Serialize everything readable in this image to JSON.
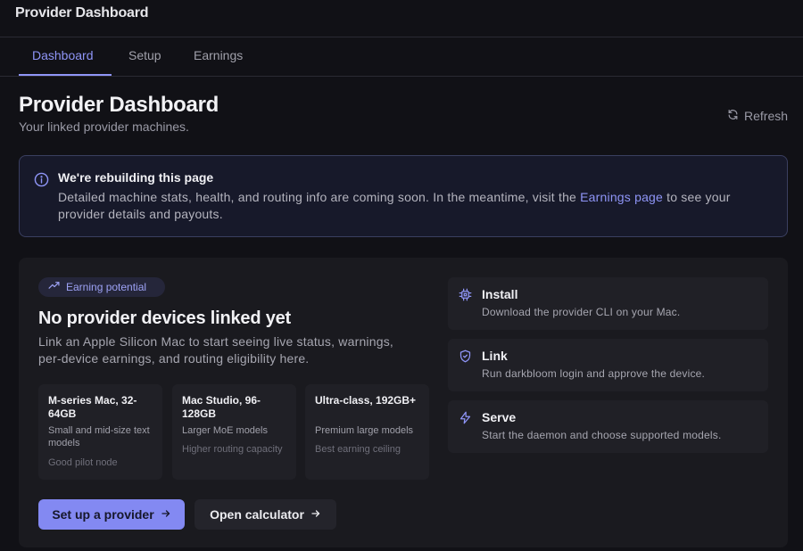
{
  "app": {
    "title": "Provider Dashboard"
  },
  "tabs": [
    {
      "label": "Dashboard",
      "active": true
    },
    {
      "label": "Setup",
      "active": false
    },
    {
      "label": "Earnings",
      "active": false
    }
  ],
  "header": {
    "title": "Provider Dashboard",
    "subtitle": "Your linked provider machines.",
    "refresh_label": "Refresh"
  },
  "notice": {
    "icon": "info-icon",
    "title": "We're rebuilding this page",
    "body_before": "Detailed machine stats, health, and routing info are coming soon. In the meantime, visit the ",
    "link_text": "Earnings page",
    "body_after": " to see your provider details and payouts."
  },
  "empty_state": {
    "badge_icon": "trending-up-icon",
    "badge_label": "Earning potential",
    "title": "No provider devices linked yet",
    "description": "Link an Apple Silicon Mac to start seeing live status, warnings, per-device earnings, and routing eligibility here.",
    "tiers": [
      {
        "name": "M-series Mac, 32-64GB",
        "description": "Small and mid-size text models",
        "note": "Good pilot node"
      },
      {
        "name": "Mac Studio, 96-128GB",
        "description": "Larger MoE models",
        "note": "Higher routing capacity"
      },
      {
        "name": "Ultra-class, 192GB+",
        "description": "Premium large models",
        "note": "Best earning ceiling"
      }
    ],
    "primary_button": "Set up a provider",
    "secondary_button": "Open calculator"
  },
  "steps": [
    {
      "icon": "chip-icon",
      "title": "Install",
      "description": "Download the provider CLI on your Mac."
    },
    {
      "icon": "shield-check-icon",
      "title": "Link",
      "description": "Run darkbloom login and approve the device."
    },
    {
      "icon": "lightning-icon",
      "title": "Serve",
      "description": "Start the daemon and choose supported models."
    }
  ],
  "colors": {
    "accent": "#8f95f7",
    "background": "#111116",
    "panel": "#1a1a1f",
    "card": "#202026",
    "notice_border": "#3a3f60"
  }
}
